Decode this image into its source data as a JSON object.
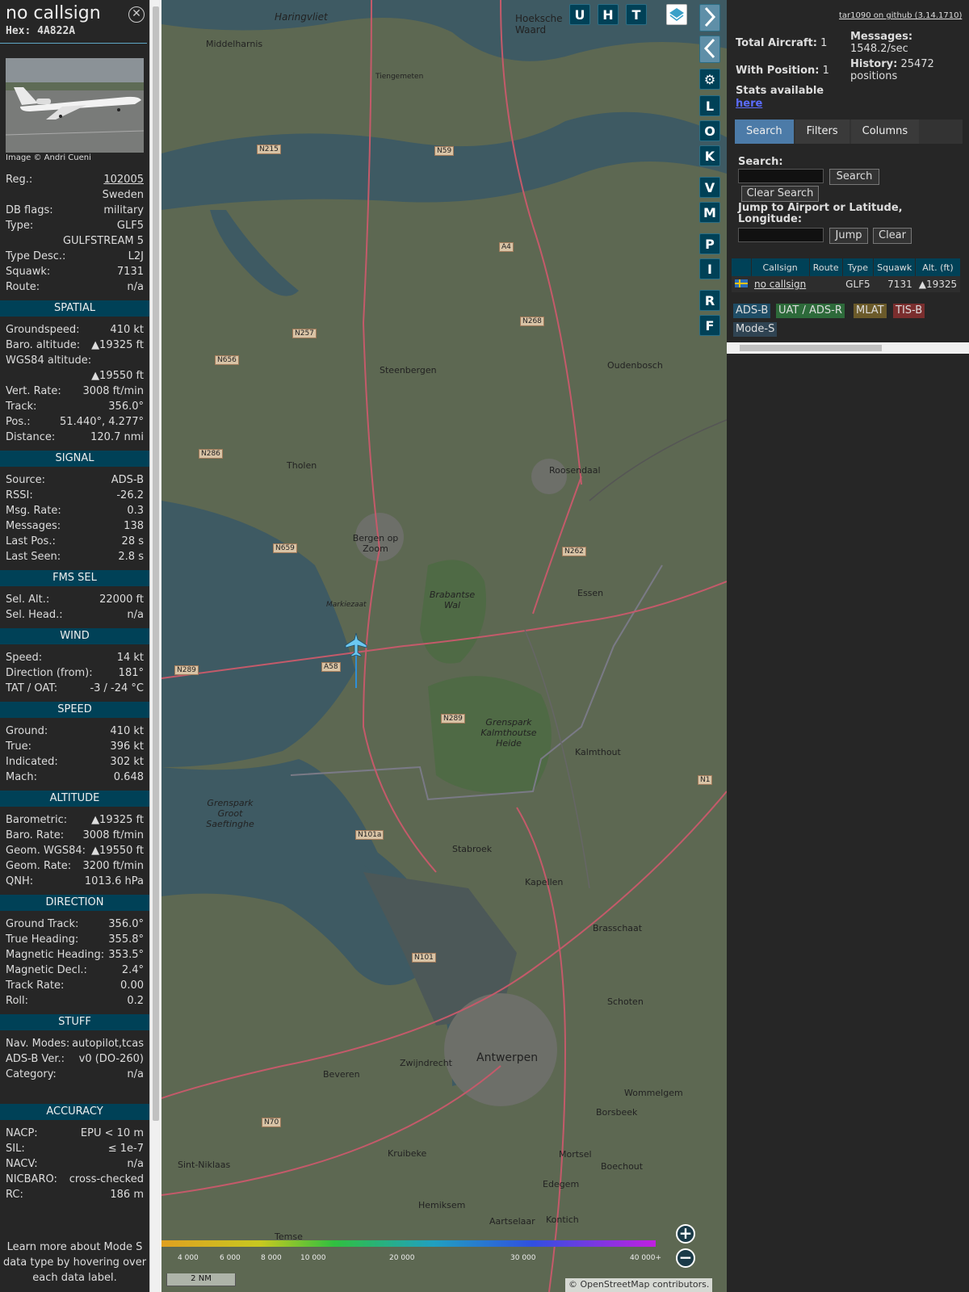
{
  "sidebar": {
    "title": "no callsign",
    "hex_label": "Hex:",
    "hex": "4A822A",
    "photo_credit": "Image © Andri Cueni",
    "rows": [
      {
        "label": "Reg.:",
        "value": "102005"
      },
      {
        "label": "",
        "value": "Sweden"
      },
      {
        "label": "DB flags:",
        "value": "military"
      },
      {
        "label": "Type:",
        "value": "GLF5"
      },
      {
        "label": "",
        "value": "GULFSTREAM 5"
      },
      {
        "label": "Type Desc.:",
        "value": "L2J"
      },
      {
        "label": "Squawk:",
        "value": "7131"
      },
      {
        "label": "Route:",
        "value": "n/a"
      }
    ],
    "spatial": {
      "title": "SPATIAL",
      "rows": [
        {
          "label": "Groundspeed:",
          "value": "410 kt"
        },
        {
          "label": "Baro. altitude:",
          "value": "▲19325 ft"
        },
        {
          "label": "WGS84 altitude:",
          "value": ""
        },
        {
          "label": "",
          "value": "▲19550 ft"
        },
        {
          "label": "Vert. Rate:",
          "value": "3008 ft/min"
        },
        {
          "label": "Track:",
          "value": "356.0°"
        },
        {
          "label": "Pos.:",
          "value": "51.440°, 4.277°"
        },
        {
          "label": "Distance:",
          "value": "120.7 nmi"
        }
      ]
    },
    "signal": {
      "title": "SIGNAL",
      "rows": [
        {
          "label": "Source:",
          "value": "ADS-B"
        },
        {
          "label": "RSSI:",
          "value": "-26.2"
        },
        {
          "label": "Msg. Rate:",
          "value": "0.3"
        },
        {
          "label": "Messages:",
          "value": "138"
        },
        {
          "label": "Last Pos.:",
          "value": "28 s"
        },
        {
          "label": "Last Seen:",
          "value": "2.8 s"
        }
      ]
    },
    "fms": {
      "title": "FMS SEL",
      "rows": [
        {
          "label": "Sel. Alt.:",
          "value": "22000 ft"
        },
        {
          "label": "Sel. Head.:",
          "value": "n/a"
        }
      ]
    },
    "wind": {
      "title": "WIND",
      "rows": [
        {
          "label": "Speed:",
          "value": "14 kt"
        },
        {
          "label": "Direction (from):",
          "value": "181°"
        },
        {
          "label": "TAT / OAT:",
          "value": "-3 / -24 °C"
        }
      ]
    },
    "speed": {
      "title": "SPEED",
      "rows": [
        {
          "label": "Ground:",
          "value": "410 kt"
        },
        {
          "label": "True:",
          "value": "396 kt"
        },
        {
          "label": "Indicated:",
          "value": "302 kt"
        },
        {
          "label": "Mach:",
          "value": "0.648"
        }
      ]
    },
    "altitude": {
      "title": "ALTITUDE",
      "rows": [
        {
          "label": "Barometric:",
          "value": "▲19325 ft"
        },
        {
          "label": "Baro. Rate:",
          "value": "3008 ft/min"
        },
        {
          "label": "Geom. WGS84:",
          "value": "▲19550 ft"
        },
        {
          "label": "Geom. Rate:",
          "value": "3200 ft/min"
        },
        {
          "label": "QNH:",
          "value": "1013.6 hPa"
        }
      ]
    },
    "direction": {
      "title": "DIRECTION",
      "rows": [
        {
          "label": "Ground Track:",
          "value": "356.0°"
        },
        {
          "label": "True Heading:",
          "value": "355.8°"
        },
        {
          "label": "Magnetic Heading:",
          "value": "353.5°"
        },
        {
          "label": "Magnetic Decl.:",
          "value": "2.4°"
        },
        {
          "label": "Track Rate:",
          "value": "0.00"
        },
        {
          "label": "Roll:",
          "value": "0.2"
        }
      ]
    },
    "stuff": {
      "title": "STUFF",
      "rows": [
        {
          "label": "Nav. Modes:",
          "value": "autopilot,tcas"
        },
        {
          "label": "ADS-B Ver.:",
          "value": "v0 (DO-260)"
        },
        {
          "label": "Category:",
          "value": "n/a"
        }
      ]
    },
    "accuracy": {
      "title": "ACCURACY",
      "rows": [
        {
          "label": "NACP:",
          "value": "EPU < 10 m"
        },
        {
          "label": "SIL:",
          "value": "≤ 1e-7"
        },
        {
          "label": "NACV:",
          "value": "n/a"
        },
        {
          "label": "NICBARO:",
          "value": "cross-checked"
        },
        {
          "label": "RC:",
          "value": "186 m"
        }
      ]
    },
    "learn_more": "Learn more about Mode S data type by hovering over each data label."
  },
  "map": {
    "buttons_top": [
      "U",
      "H",
      "T"
    ],
    "buttons_side": [
      "L",
      "O",
      "K",
      "V",
      "M",
      "P",
      "I",
      "R",
      "F"
    ],
    "places": [
      {
        "name": "Haringvliet"
      },
      {
        "name": "Middelharnis"
      },
      {
        "name": "Tiengemeten"
      },
      {
        "name": "Steenbergen"
      },
      {
        "name": "Tholen"
      },
      {
        "name": "Bergen op Zoom"
      },
      {
        "name": "Roosendaal"
      },
      {
        "name": "Essen"
      },
      {
        "name": "Brabantse Wal"
      },
      {
        "name": "Kalmthout"
      },
      {
        "name": "Stabroek"
      },
      {
        "name": "Kapellen"
      },
      {
        "name": "Brasschaat"
      },
      {
        "name": "Schoten"
      },
      {
        "name": "Antwerpen"
      },
      {
        "name": "Beveren"
      },
      {
        "name": "Zwijndrecht"
      },
      {
        "name": "Wommelgem"
      },
      {
        "name": "Borsbeek"
      },
      {
        "name": "Mortsel"
      },
      {
        "name": "Boechout"
      },
      {
        "name": "Edegem"
      },
      {
        "name": "Kruibeke"
      },
      {
        "name": "Hemiksem"
      },
      {
        "name": "Aartselaar"
      },
      {
        "name": "Kontich"
      },
      {
        "name": "Sint-Niklaas"
      },
      {
        "name": "Temse"
      },
      {
        "name": "Oudenbosch"
      },
      {
        "name": "Grenspark Groot Saeftinghe"
      },
      {
        "name": "Grenspark Kalmthoutse Heide"
      },
      {
        "name": "Markiezaat"
      },
      {
        "name": "Hoeksche Waard"
      }
    ],
    "roads": [
      "N215",
      "N59",
      "A4",
      "N268",
      "N257",
      "N656",
      "N286",
      "N659",
      "N262",
      "N289",
      "A58",
      "N289",
      "N1",
      "N101a",
      "N101",
      "N70"
    ],
    "scale_labels": [
      "4 000",
      "6 000",
      "8 000",
      "10 000",
      "20 000",
      "30 000",
      "40 000+"
    ],
    "scale_bar": "2 NM",
    "attribution": "© OpenStreetMap contributors.",
    "zoom_in": "+",
    "zoom_out": "−"
  },
  "panel": {
    "github": "tar1090 on github (3.14.1710)",
    "total_label": "Total Aircraft:",
    "total": "1",
    "withpos_label": "With Position:",
    "withpos": "1",
    "messages_label": "Messages:",
    "messages": "1548.2/sec",
    "history_label": "History:",
    "history": "25472",
    "history_unit": "positions",
    "stats_label": "Stats available",
    "stats_link": "here",
    "tabs": [
      "Search",
      "Filters",
      "Columns"
    ],
    "search_label": "Search:",
    "search_btn": "Search",
    "clear_search_btn": "Clear Search",
    "jump_label": "Jump to Airport or Latitude, Longitude:",
    "jump_btn": "Jump",
    "clear_btn": "Clear",
    "table": {
      "headers": [
        "",
        "Callsign",
        "Route",
        "Type",
        "Squawk",
        "Alt. (ft)"
      ],
      "row": {
        "callsign": "no callsign",
        "route": "",
        "type": "GLF5",
        "squawk": "7131",
        "alt": "▲19325"
      }
    },
    "legend": [
      {
        "label": "ADS-B",
        "color": "#1f4d66"
      },
      {
        "label": "UAT / ADS-R",
        "color": "#2d6a3a"
      },
      {
        "label": "MLAT",
        "color": "#6b5a2a"
      },
      {
        "label": "TIS-B",
        "color": "#7a2e2e"
      },
      {
        "label": "Mode-S",
        "color": "#2f4352"
      }
    ]
  }
}
